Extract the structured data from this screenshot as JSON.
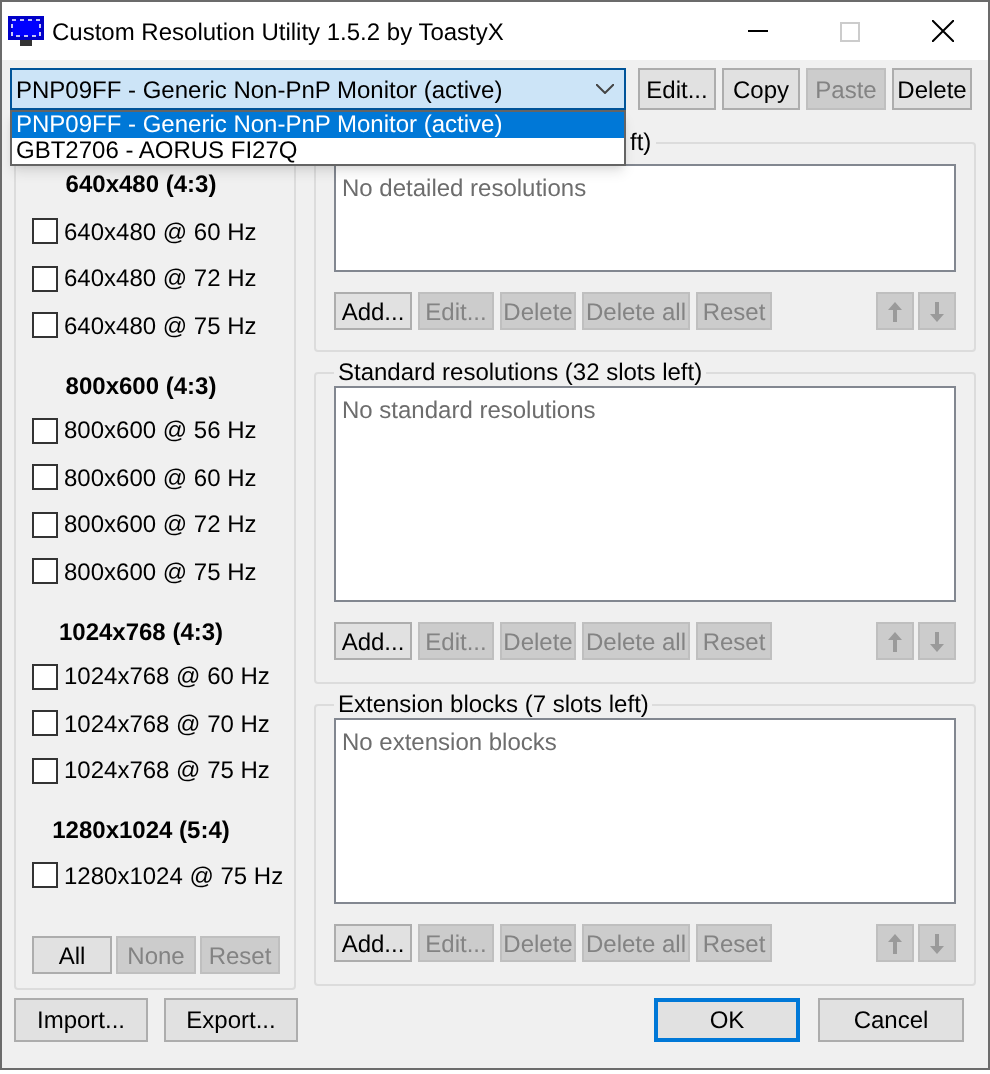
{
  "window": {
    "title": "Custom Resolution Utility 1.5.2 by ToastyX",
    "maximize_disabled": true
  },
  "monitor_select": {
    "value": "PNP09FF - Generic Non-PnP Monitor (active)",
    "expanded": true,
    "options": [
      {
        "label": "PNP09FF - Generic Non-PnP Monitor (active)",
        "selected": true
      },
      {
        "label": "GBT2706 - AORUS FI27Q",
        "selected": false
      }
    ]
  },
  "toolbar": [
    {
      "label": "Edit...",
      "disabled": false
    },
    {
      "label": "Copy",
      "disabled": false
    },
    {
      "label": "Paste",
      "disabled": true
    },
    {
      "label": "Delete",
      "disabled": false
    }
  ],
  "established": {
    "groups": [
      {
        "heading": "640x480 (4:3)",
        "items": [
          {
            "label": "640x480 @ 60 Hz",
            "checked": false
          },
          {
            "label": "640x480 @ 72 Hz",
            "checked": false
          },
          {
            "label": "640x480 @ 75 Hz",
            "checked": false
          }
        ]
      },
      {
        "heading": "800x600 (4:3)",
        "items": [
          {
            "label": "800x600 @ 56 Hz",
            "checked": false
          },
          {
            "label": "800x600 @ 60 Hz",
            "checked": false
          },
          {
            "label": "800x600 @ 72 Hz",
            "checked": false
          },
          {
            "label": "800x600 @ 75 Hz",
            "checked": false
          }
        ]
      },
      {
        "heading": "1024x768 (4:3)",
        "items": [
          {
            "label": "1024x768 @ 60 Hz",
            "checked": false
          },
          {
            "label": "1024x768 @ 70 Hz",
            "checked": false
          },
          {
            "label": "1024x768 @ 75 Hz",
            "checked": false
          }
        ]
      },
      {
        "heading": "1280x1024 (5:4)",
        "items": [
          {
            "label": "1280x1024 @ 75 Hz",
            "checked": false
          }
        ]
      }
    ],
    "buttons": [
      {
        "label": "All",
        "disabled": false
      },
      {
        "label": "None",
        "disabled": true
      },
      {
        "label": "Reset",
        "disabled": true
      }
    ]
  },
  "sections": [
    {
      "title": "ft)",
      "empty_text": "No detailed resolutions",
      "buttons": [
        {
          "label": "Add...",
          "disabled": false
        },
        {
          "label": "Edit...",
          "disabled": true
        },
        {
          "label": "Delete",
          "disabled": true
        },
        {
          "label": "Delete all",
          "disabled": true
        },
        {
          "label": "Reset",
          "disabled": true
        }
      ],
      "move_buttons": [
        {
          "kind": "up",
          "disabled": true
        },
        {
          "kind": "down",
          "disabled": true
        }
      ]
    },
    {
      "title": "Standard resolutions (32 slots left)",
      "empty_text": "No standard resolutions",
      "buttons": [
        {
          "label": "Add...",
          "disabled": false
        },
        {
          "label": "Edit...",
          "disabled": true
        },
        {
          "label": "Delete",
          "disabled": true
        },
        {
          "label": "Delete all",
          "disabled": true
        },
        {
          "label": "Reset",
          "disabled": true
        }
      ],
      "move_buttons": [
        {
          "kind": "up",
          "disabled": true
        },
        {
          "kind": "down",
          "disabled": true
        }
      ]
    },
    {
      "title": "Extension blocks (7 slots left)",
      "empty_text": "No extension blocks",
      "buttons": [
        {
          "label": "Add...",
          "disabled": false
        },
        {
          "label": "Edit...",
          "disabled": true
        },
        {
          "label": "Delete",
          "disabled": true
        },
        {
          "label": "Delete all",
          "disabled": true
        },
        {
          "label": "Reset",
          "disabled": true
        }
      ],
      "move_buttons": [
        {
          "kind": "up",
          "disabled": true
        },
        {
          "kind": "down",
          "disabled": true
        }
      ]
    }
  ],
  "footer": {
    "left": [
      {
        "label": "Import...",
        "default": false
      },
      {
        "label": "Export...",
        "default": false
      }
    ],
    "right": [
      {
        "label": "OK",
        "default": true
      },
      {
        "label": "Cancel",
        "default": false
      }
    ]
  }
}
